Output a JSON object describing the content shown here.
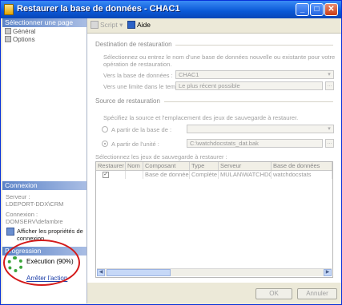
{
  "window": {
    "title": "Restaurer la base de données - CHAC1",
    "minimize": "_",
    "maximize": "□",
    "close": "✕"
  },
  "left": {
    "select_page_header": "Sélectionner une page",
    "pages": [
      {
        "label": "Général",
        "icon": "page-icon"
      },
      {
        "label": "Options",
        "icon": "page-icon"
      }
    ],
    "connection_header": "Connexion",
    "server_label": "Serveur :",
    "server_value": "LDEPORT-DDX\\CRM",
    "connection_label": "Connexion :",
    "connection_value": "DOMSERV\\defambre",
    "view_props_link": "Afficher les propriétés de connexion",
    "progress_header": "Progression",
    "progress_status": "Exécution (90%)",
    "progress_percent": 90,
    "stop_link": "Arrêter l'action"
  },
  "toolbar": {
    "script_label": "Script",
    "help_label": "Aide"
  },
  "destination": {
    "group_title": "Destination de restauration",
    "description": "Sélectionnez ou entrez le nom d'une base de données nouvelle ou existante pour votre opération de restauration.",
    "db_label": "Vers la base de données :",
    "db_value": "CHAC1",
    "time_label": "Vers une limite dans le temps :",
    "time_value": "Le plus récent possible"
  },
  "source": {
    "group_title": "Source de restauration",
    "description": "Spécifiez la source et l'emplacement des jeux de sauvegarde à restaurer.",
    "from_db_label": "A partir de la base de :",
    "from_device_label": "A partir de l'unité :",
    "device_value": "C:\\watchdocstats_dat.bak",
    "sets_label": "Sélectionnez les jeux de sauvegarde à restaurer :"
  },
  "grid": {
    "columns": [
      "Restaurer",
      "Nom",
      "Composant",
      "Type",
      "Serveur",
      "Base de données"
    ],
    "rows": [
      {
        "restore": "✓",
        "name": "",
        "component": "Base de données",
        "type": "Complète",
        "server": "MULAN\\WATCHDOC",
        "database": "watchdocstats"
      }
    ]
  },
  "buttons": {
    "ok": "OK",
    "cancel": "Annuler"
  }
}
